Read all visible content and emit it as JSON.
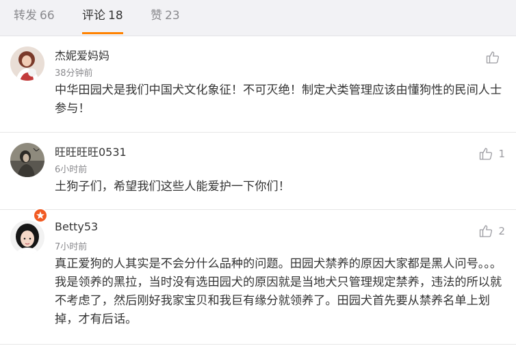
{
  "tabs": [
    {
      "label": "转发",
      "count": "66",
      "active": false
    },
    {
      "label": "评论",
      "count": "18",
      "active": true
    },
    {
      "label": "赞",
      "count": "23",
      "active": false
    }
  ],
  "comments": [
    {
      "name": "杰妮爱妈妈",
      "time": "38分钟前",
      "text": "中华田园犬是我们中国犬文化象征！不可灭绝！制定犬类管理应该由懂狗性的民间人士参与！",
      "likes": ""
    },
    {
      "name": "旺旺旺旺0531",
      "time": "6小时前",
      "text": "土狗子们，希望我们这些人能爱护一下你们！",
      "likes": "1"
    },
    {
      "name": "Betty53",
      "time": "7小时前",
      "text": "真正爱狗的人其实是不会分什么品种的问题。田园犬禁养的原因大家都是黑人问号。。。我是领养的黑拉，当时没有选田园犬的原因就是当地犬只管理规定禁养，违法的所以就不考虑了，然后刚好我家宝贝和我巨有缘分就领养了。田园犬首先要从禁养名单上划掉，才有后话。",
      "likes": "2"
    }
  ],
  "icons": {
    "like": "thumbs-up-icon",
    "verified": "verified-badge-icon"
  },
  "colors": {
    "accent": "#ff8200",
    "muted": "#8a8a8e",
    "badge": "#f15a22"
  }
}
